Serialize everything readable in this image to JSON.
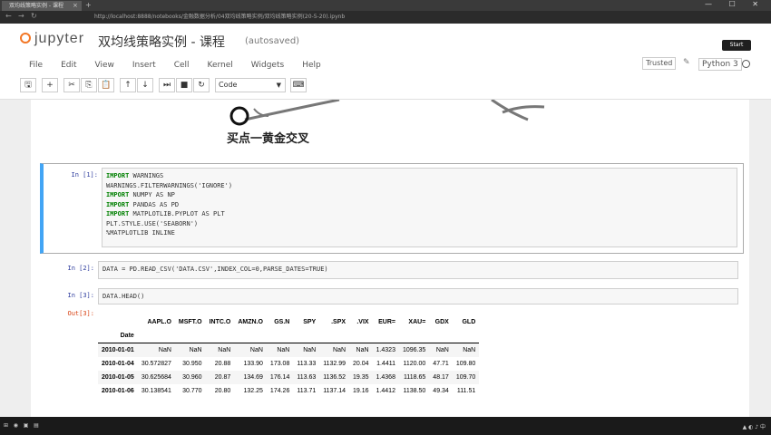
{
  "browser": {
    "tab_title": "双均线策略实例 - 课程",
    "tab_close": "×",
    "new_tab": "+",
    "url": "http://localhost:8888/notebooks/金融数据分析/04双均线策略实例/双均线策略实例(20-5-20).ipynb",
    "back": "←",
    "forward": "→",
    "reload": "↻",
    "window_buttons": "— ☐ ✕"
  },
  "header": {
    "logo": "jupyter",
    "title": "双均线策略实例 - 课程",
    "autosave": "(autosaved)",
    "logout_label": "Start"
  },
  "menu": [
    "File",
    "Edit",
    "View",
    "Insert",
    "Cell",
    "Kernel",
    "Widgets",
    "Help"
  ],
  "status": {
    "trusted": "Trusted",
    "kernel": "Python 3"
  },
  "toolbar": {
    "cell_type": "Code"
  },
  "markdown": {
    "caption": "买点一黄金交叉"
  },
  "cells": [
    {
      "prompt": "In  [1]:",
      "lines": [
        [
          "IMPORT",
          " WARNINGS"
        ],
        [
          "",
          "WARNINGS.FILTERWARNINGS('IGNORE')"
        ],
        [
          "IMPORT",
          " NUMPY AS NP"
        ],
        [
          "IMPORT",
          " PANDAS AS PD"
        ],
        [
          "IMPORT",
          " MATPLOTLIB.PYPLOT AS PLT"
        ],
        [
          "",
          "PLT.STYLE.USE('SEABORN')"
        ],
        [
          "",
          "%MATPLOTLIB INLINE"
        ]
      ]
    },
    {
      "prompt": "In  [2]:",
      "code": "DATA = PD.READ_CSV('DATA.CSV',INDEX_COL=0,PARSE_DATES=TRUE)"
    },
    {
      "prompt": "In  [3]:",
      "code": "DATA.HEAD()"
    }
  ],
  "output": {
    "prompt": "Out[3]:",
    "columns": [
      "AAPL.O",
      "MSFT.O",
      "INTC.O",
      "AMZN.O",
      "GS.N",
      "SPY",
      ".SPX",
      ".VIX",
      "EUR=",
      "XAU=",
      "GDX",
      "GLD"
    ],
    "index_name": "Date",
    "rows": [
      {
        "date": "2010-01-01",
        "values": [
          "NaN",
          "NaN",
          "NaN",
          "NaN",
          "NaN",
          "NaN",
          "NaN",
          "NaN",
          "1.4323",
          "1096.35",
          "NaN",
          "NaN"
        ]
      },
      {
        "date": "2010-01-04",
        "values": [
          "30.572827",
          "30.950",
          "20.88",
          "133.90",
          "173.08",
          "113.33",
          "1132.99",
          "20.04",
          "1.4411",
          "1120.00",
          "47.71",
          "109.80"
        ]
      },
      {
        "date": "2010-01-05",
        "values": [
          "30.625684",
          "30.960",
          "20.87",
          "134.69",
          "176.14",
          "113.63",
          "1136.52",
          "19.35",
          "1.4368",
          "1118.65",
          "48.17",
          "109.70"
        ]
      },
      {
        "date": "2010-01-06",
        "values": [
          "30.138541",
          "30.770",
          "20.80",
          "132.25",
          "174.26",
          "113.71",
          "1137.14",
          "19.16",
          "1.4412",
          "1138.50",
          "49.34",
          "111.51"
        ]
      }
    ]
  }
}
